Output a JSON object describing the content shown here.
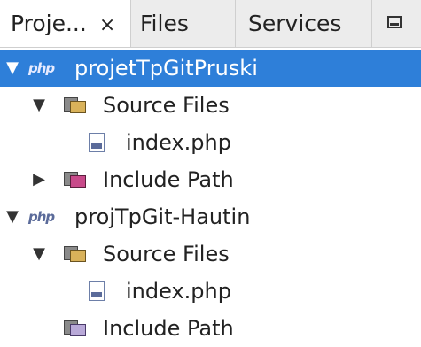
{
  "tabs": [
    {
      "label": "Proje...",
      "close": "×"
    },
    {
      "label": "Files"
    },
    {
      "label": "Services"
    }
  ],
  "tree": {
    "project1": {
      "name": "projetTpGitPruski",
      "icon_text": "php",
      "expanded": true,
      "selected": true
    },
    "project1_source": {
      "name": "Source Files"
    },
    "project1_file": {
      "name": "index.php"
    },
    "project1_include": {
      "name": "Include Path"
    },
    "project2": {
      "name": "projTpGit-Hautin",
      "icon_text": "php",
      "expanded": true
    },
    "project2_source": {
      "name": "Source Files"
    },
    "project2_file": {
      "name": "index.php"
    },
    "project2_include": {
      "name": "Include Path"
    }
  },
  "colors": {
    "selection": "#2e7fd9",
    "tab_bar": "#ececec"
  },
  "icons": {
    "expanded": "▼",
    "collapsed": "▶",
    "minimize": "minimize-icon"
  }
}
